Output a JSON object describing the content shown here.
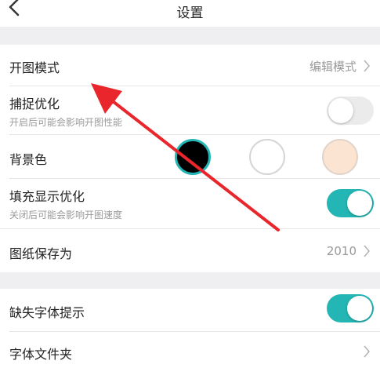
{
  "header": {
    "title": "设置"
  },
  "settings": {
    "open_mode": {
      "label": "开图模式",
      "value": "编辑模式"
    },
    "capture_opt": {
      "label": "捕捉优化",
      "sub": "开启后可能会影响开图性能",
      "enabled": false
    },
    "background_color": {
      "label": "背景色",
      "options": [
        "black",
        "white",
        "peach"
      ],
      "selected": "black"
    },
    "fill_display_opt": {
      "label": "填充显示优化",
      "sub": "关闭后可能会影响开图速度",
      "enabled": true
    },
    "save_drawing_as": {
      "label": "图纸保存为",
      "value": "2010"
    },
    "missing_font_hint": {
      "label": "缺失字体提示",
      "enabled": true
    },
    "font_folder": {
      "label": "字体文件夹"
    }
  },
  "colors": {
    "accent": "#24b6b4",
    "annotation_arrow": "#e8262b",
    "peach_swatch": "#fbe4d2"
  }
}
